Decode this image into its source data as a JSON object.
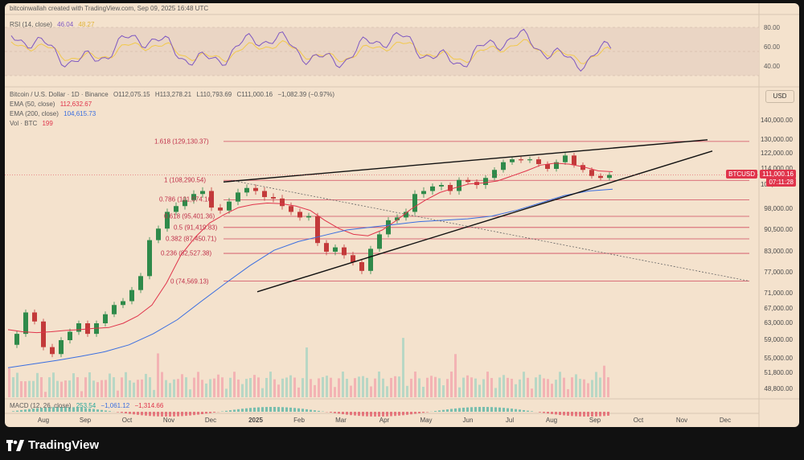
{
  "header": {
    "credit": "bitcoinwallah created with TradingView.com, Sep 09, 2025 16:48 UTC"
  },
  "rsi": {
    "label": "RSI (14, close)",
    "value": "46.04",
    "ma_value": "48.27",
    "levels": [
      "80.00",
      "60.00",
      "40.00"
    ],
    "colors": {
      "line": "#7e57c2",
      "ma": "#f2c94c",
      "band": "#e8d2c0"
    }
  },
  "main": {
    "title": "Bitcoin / U.S. Dollar · 1D · Binance",
    "ohlc": {
      "o": "O112,075.15",
      "h": "H113,278.21",
      "l": "L110,793.69",
      "c": "C111,000.16",
      "chg": "−1,082.39 (−0.97%)"
    },
    "ema50": {
      "label": "EMA (50, close)",
      "value": "112,632.67",
      "color": "#e0344b"
    },
    "ema200": {
      "label": "EMA (200, close)",
      "value": "104,615.73",
      "color": "#3a6ee0"
    },
    "vol": {
      "label": "Vol · BTC",
      "value": "199"
    },
    "currency": "USD",
    "price_tag": "111,000.16",
    "symbol_tag": "BTCUSD",
    "countdown": "07:11:28",
    "upper_tags": [
      "106,000.00"
    ]
  },
  "macd": {
    "label": "MACD (12, 26, close)",
    "v1": "253.54",
    "v2": "−1,061.12",
    "v3": "−1,314.66"
  },
  "chart_data": {
    "type": "line",
    "y_ticks": [
      "140,000.00",
      "130,000.00",
      "122,000.00",
      "114,000.00",
      "106,000.00",
      "98,000.00",
      "90,500.00",
      "83,000.00",
      "77,000.00",
      "71,000.00",
      "67,000.00",
      "63,000.00",
      "59,000.00",
      "55,000.00",
      "51,800.00",
      "48,800.00"
    ],
    "x_ticks": [
      "Aug",
      "Sep",
      "Oct",
      "Nov",
      "Dec",
      "2025",
      "Feb",
      "Mar",
      "Apr",
      "May",
      "Jun",
      "Jul",
      "Aug",
      "Sep",
      "Oct",
      "Nov",
      "Dec"
    ],
    "fib_levels": [
      {
        "label": "1.618 (129,130.37)",
        "price": 129130.37
      },
      {
        "label": "1 (108,290.54)",
        "price": 108290.54
      },
      {
        "label": "0.786 (101,074.16)",
        "price": 101074.16
      },
      {
        "label": "0.618 (95,401.36)",
        "price": 95401.36
      },
      {
        "label": "0.5 (91,419.83)",
        "price": 91419.83
      },
      {
        "label": "0.382 (87,450.71)",
        "price": 87450.71
      },
      {
        "label": "0.236 (82,527.38)",
        "price": 82527.38
      },
      {
        "label": "0 (74,569.13)",
        "price": 74569.13
      }
    ],
    "price_series": [
      58000,
      60500,
      66000,
      63500,
      57500,
      56000,
      59000,
      61000,
      63000,
      60500,
      63000,
      65500,
      68000,
      69000,
      72000,
      76000,
      87000,
      91000,
      97000,
      99000,
      101000,
      103000,
      104000,
      98500,
      97500,
      100500,
      103500,
      105000,
      104000,
      102000,
      101500,
      99000,
      97000,
      95000,
      95500,
      86000,
      83000,
      84500,
      82000,
      80000,
      77500,
      84000,
      89000,
      94000,
      95000,
      97000,
      103000,
      104000,
      105500,
      106000,
      104000,
      108500,
      107500,
      106000,
      109500,
      113500,
      117500,
      119000,
      118500,
      119000,
      116500,
      114000,
      117500,
      121000,
      116000,
      113500,
      110500,
      109500,
      111000
    ],
    "ema50": [
      61500,
      61000,
      60800,
      61000,
      61300,
      61500,
      61800,
      62000,
      63000,
      65000,
      68000,
      74000,
      82000,
      88000,
      93000,
      96000,
      98500,
      99500,
      100000,
      99800,
      99000,
      97500,
      94000,
      91000,
      89000,
      88500,
      90500,
      94000,
      98000,
      101000,
      103500,
      105000,
      106500,
      107000,
      108000,
      110500,
      113000,
      116000,
      117000,
      116500,
      115000,
      113000,
      112600
    ],
    "ema200": [
      53000,
      53800,
      54600,
      55500,
      56500,
      58000,
      60500,
      64000,
      69000,
      74000,
      79000,
      83500,
      86500,
      88500,
      90500,
      91500,
      92500,
      93500,
      94000,
      94500,
      95500,
      97500,
      100000,
      102500,
      104000,
      104600
    ],
    "colors": {
      "up": "#26a69a",
      "down": "#e0344b",
      "candles_up": "#2f8a4a",
      "candles_down": "#c33a3a"
    }
  }
}
